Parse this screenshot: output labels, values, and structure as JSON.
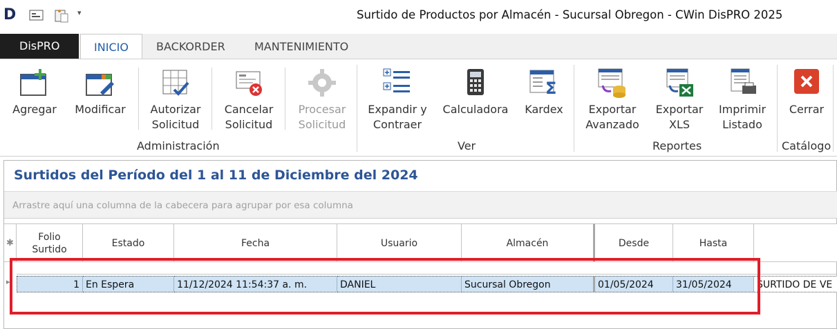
{
  "app": {
    "logo": "D",
    "window_title": "Surtido de Productos por Almacén - Sucursal Obregon - CWin DisPRO 2025"
  },
  "tabs": [
    {
      "label": "DisPRO"
    },
    {
      "label": "INICIO"
    },
    {
      "label": "BACKORDER"
    },
    {
      "label": "MANTENIMIENTO"
    }
  ],
  "ribbon": {
    "agregar": "Agregar",
    "modificar": "Modificar",
    "autorizar_1": "Autorizar",
    "autorizar_2": "Solicitud",
    "cancelar_1": "Cancelar",
    "cancelar_2": "Solicitud",
    "procesar_1": "Procesar",
    "procesar_2": "Solicitud",
    "expandir_1": "Expandir y",
    "expandir_2": "Contraer",
    "calculadora": "Calculadora",
    "kardex": "Kardex",
    "exportar_av_1": "Exportar",
    "exportar_av_2": "Avanzado",
    "exportar_xls_1": "Exportar",
    "exportar_xls_2": "XLS",
    "imprimir_1": "Imprimir",
    "imprimir_2": "Listado",
    "cerrar": "Cerrar",
    "groups": {
      "administracion": "Administración",
      "ver": "Ver",
      "reportes": "Reportes",
      "catalogo": "Catálogo"
    }
  },
  "panel": {
    "title": "Surtidos del Período del 1 al 11 de Diciembre del 2024",
    "group_hint": "Arrastre aquí una columna de la cabecera para agrupar por esa columna"
  },
  "grid": {
    "columns": {
      "folio_1": "Folio",
      "folio_2": "Surtido",
      "estado": "Estado",
      "fecha": "Fecha",
      "usuario": "Usuario",
      "almacen": "Almacén",
      "desde": "Desde",
      "hasta": "Hasta"
    },
    "row": {
      "folio": "1",
      "estado": "En Espera",
      "fecha": "11/12/2024 11:54:37 a. m.",
      "usuario": "DANIEL",
      "almacen": "Sucursal Obregon",
      "desde": "01/05/2024",
      "hasta": "31/05/2024",
      "observaciones": "SURTIDO DE VE"
    }
  },
  "colors": {
    "accent": "#2d5595",
    "selection": "#cfe3f5",
    "highlight": "#e01e2a"
  }
}
